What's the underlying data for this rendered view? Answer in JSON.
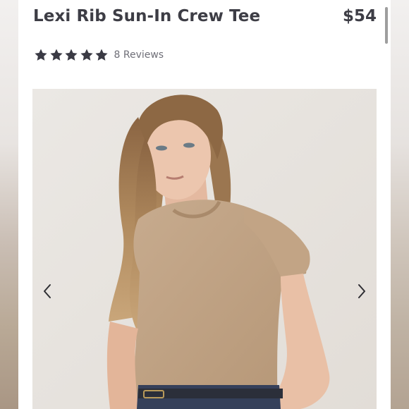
{
  "product": {
    "title": "Lexi Rib Sun-In Crew Tee",
    "price": "$54"
  },
  "rating": {
    "stars": 5,
    "max_stars": 5,
    "reviews_label": "8 Reviews",
    "star_icon": "star-icon",
    "star_color": "#3a3a44"
  },
  "gallery": {
    "prev_icon": "chevron-left-icon",
    "next_icon": "chevron-right-icon"
  },
  "colors": {
    "text": "#3d3d45",
    "muted": "#6f6f78",
    "tee": "#c1a487",
    "photo_bg": "#e9e6e2"
  }
}
